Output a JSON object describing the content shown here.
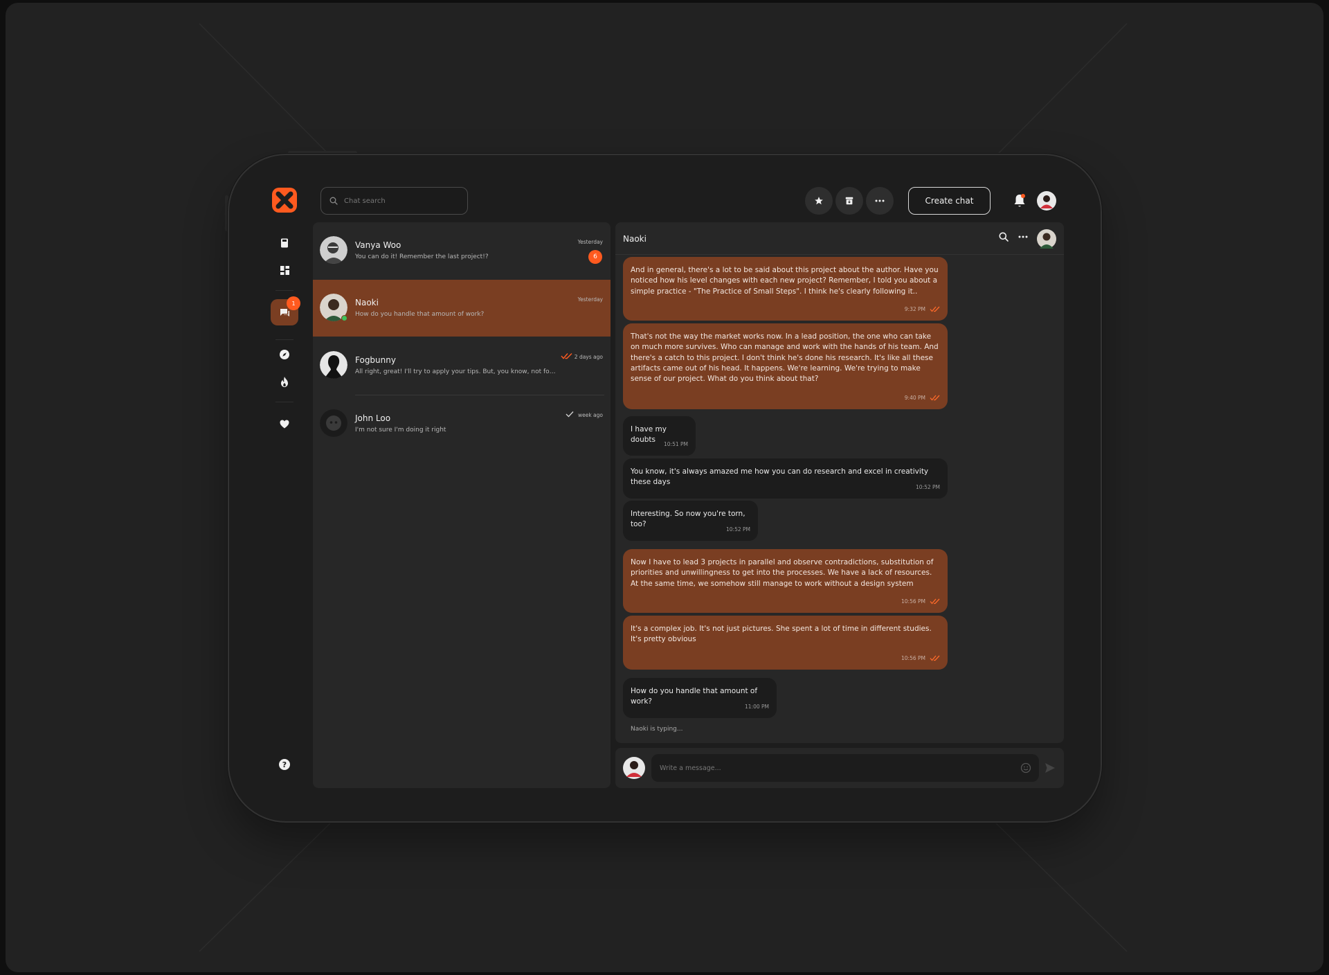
{
  "app": {
    "search_placeholder": "Chat search",
    "create_chat_label": "Create chat",
    "nav_badge_count": "1",
    "colors": {
      "accent": "#ff5a1f",
      "active_bg": "#7a3e22",
      "panel_bg": "#272727",
      "device_bg": "#1d1d1d"
    }
  },
  "chats": [
    {
      "name": "Vanya Woo",
      "preview": "You can do it! Remember the last project!?",
      "time": "Yesterday",
      "unread": "6"
    },
    {
      "name": "Naoki",
      "preview": "How do you handle that amount of work?",
      "time": "Yesterday"
    },
    {
      "name": "Fogbunny",
      "preview": "All right, great! I'll try to apply your tips. But, you know, not for a...",
      "time": "2 days ago"
    },
    {
      "name": "John Loo",
      "preview": "I'm not sure I'm doing it right",
      "time": "week ago"
    }
  ],
  "conversation": {
    "title": "Naoki",
    "messages": [
      {
        "dir": "out",
        "text": "And in general, there's a lot to be said about this project about the author. Have you noticed how his level changes with each new project? Remember, I told you about a simple practice - \"The Practice of Small Steps\". I think he's clearly following it..",
        "time": "9:32 PM"
      },
      {
        "dir": "out",
        "text": "That's not the way the market works now.  In a lead position, the one who can take on much more survives. Who can manage and work with the hands of his team. And there's a catch to this project. I don't think he's done his research. It's like all these artifacts came out of his head. It happens. We're learning. We're trying to make sense of our project. What do you think about that?",
        "time": "9:40 PM"
      },
      {
        "dir": "in",
        "text": "I have my doubts",
        "time": "10:51 PM"
      },
      {
        "dir": "in",
        "text": "You know, it's always amazed me how you can do research and excel in creativity these days",
        "time": "10:52 PM"
      },
      {
        "dir": "in",
        "text": "Interesting. So now you're torn, too?",
        "time": "10:52 PM"
      },
      {
        "dir": "out",
        "text": "Now I have to lead 3 projects in parallel and observe contradictions, substitution of priorities and unwillingness to get into the processes. We have a lack of resources. At the same time, we somehow still manage to work without a design system",
        "time": "10:56 PM"
      },
      {
        "dir": "out",
        "text": "It's a complex job. It's not just pictures. She spent a lot of time in different studies. It's pretty obvious",
        "time": "10:56 PM"
      },
      {
        "dir": "in",
        "text": "How do you handle that amount of work?",
        "time": "11:00 PM"
      }
    ],
    "typing": "Naoki is typing...",
    "composer_placeholder": "Write a message..."
  }
}
